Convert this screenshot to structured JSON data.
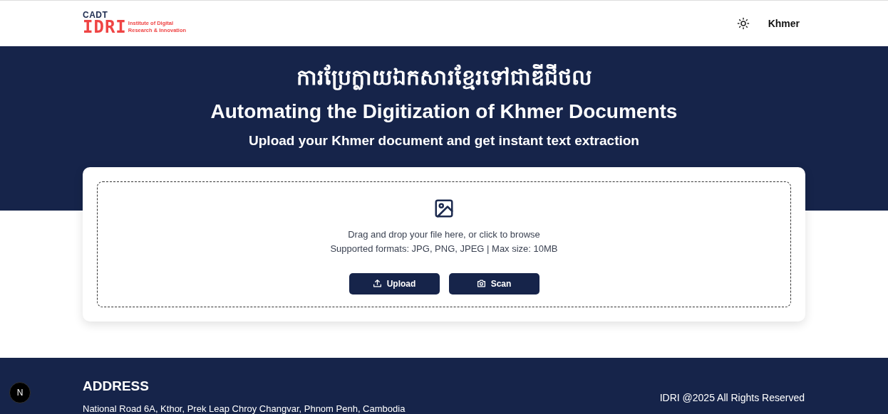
{
  "header": {
    "logo": {
      "top": "CADT",
      "main": "IDRI",
      "tagline_1": "Institute of Digital",
      "tagline_2": "Research & Innovation"
    },
    "language": "Khmer"
  },
  "hero": {
    "title_khmer": "ការប្រែក្លាយឯកសារខ្មែរទៅជាឌីជីថល",
    "title": "Automating the Digitization of Khmer Documents",
    "subtitle": "Upload your Khmer document and get instant text extraction"
  },
  "upload": {
    "instruction": "Drag and drop your file here, or click to browse",
    "formats": "Supported formats: JPG, PNG, JPEG | Max size: 10MB",
    "buttons": [
      {
        "kind": "upload",
        "label": "Upload"
      },
      {
        "kind": "scan",
        "label": "Scan"
      }
    ]
  },
  "footer": {
    "heading": "ADDRESS",
    "address": "National Road 6A, Kthor, Prek Leap Chroy Changvar, Phnom Penh, Cambodia",
    "copyright": "IDRI @2025 All Rights Reserved",
    "badge": "N"
  }
}
